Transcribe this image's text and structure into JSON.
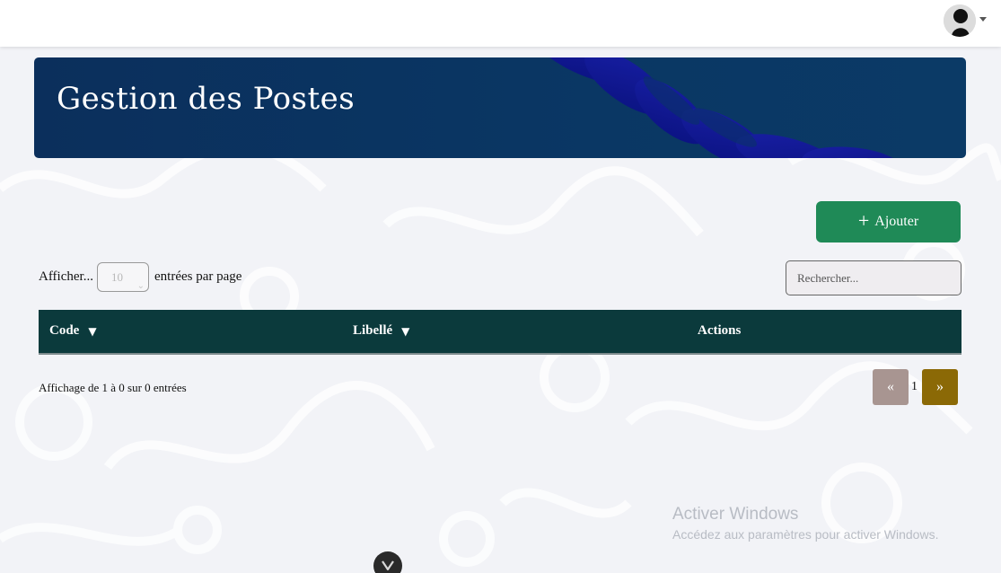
{
  "header": {
    "avatar_icon": "user-avatar-icon",
    "caret_icon": "caret-down-icon"
  },
  "banner": {
    "title": "Gestion des Postes"
  },
  "toolbar": {
    "add_label": "Ajouter",
    "add_icon": "plus-icon",
    "add_color": "#1f8a57"
  },
  "length_control": {
    "prefix": "Afficher...",
    "value": "10",
    "suffix": "entrées par page"
  },
  "search": {
    "placeholder": "Rechercher..."
  },
  "table": {
    "header_color": "#0b3a3c",
    "columns": [
      {
        "label": "Code",
        "sort_icon": "▼"
      },
      {
        "label": "Libellé",
        "sort_icon": "▼"
      },
      {
        "label": "Actions"
      }
    ]
  },
  "footer": {
    "info": "Affichage de 1 à 0 sur 0 entrées",
    "prev_label": "«",
    "current_page": "1",
    "next_label": "»"
  },
  "watermark": {
    "title": "Activer Windows",
    "subtitle": "Accédez aux paramètres pour activer Windows."
  }
}
